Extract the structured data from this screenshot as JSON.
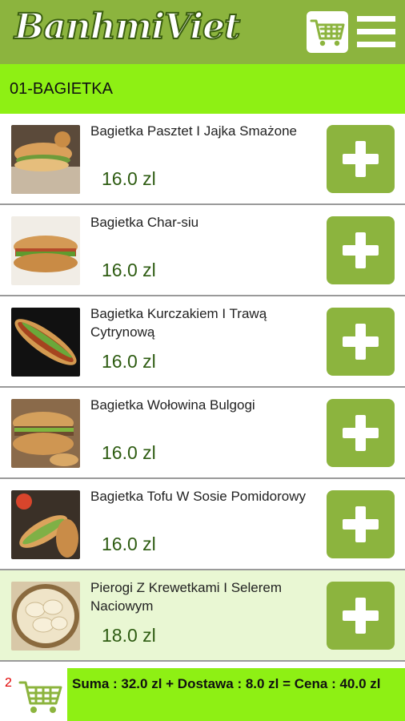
{
  "app": {
    "logo_text": "BanhmiViet"
  },
  "header": {
    "cart_icon": "shopping-cart-icon",
    "menu_icon": "hamburger-menu-icon"
  },
  "category": {
    "label": "01-BAGIETKA"
  },
  "items": [
    {
      "name": "Bagietka Pasztet I Jajka Smażone",
      "price": "16.0 zl"
    },
    {
      "name": "Bagietka Char-siu",
      "price": "16.0 zl"
    },
    {
      "name": "Bagietka Kurczakiem I Trawą Cytrynową",
      "price": "16.0 zl"
    },
    {
      "name": "Bagietka Wołowina Bulgogi",
      "price": "16.0 zl"
    },
    {
      "name": "Bagietka Tofu W Sosie Pomidorowy",
      "price": "16.0 zl"
    },
    {
      "name": "Pierogi Z Krewetkami I Selerem Naciowym",
      "price": "18.0 zl"
    }
  ],
  "footer": {
    "cart_count": "2",
    "summary": "Suma : 32.0 zl  +  Dostawa  : 8.0 zl  =  Cena : 40.0 zl"
  },
  "colors": {
    "header": "#8cb43e",
    "category_bar": "#8ef014",
    "price_text": "#2e5c12",
    "add_button": "#8cb43e"
  }
}
